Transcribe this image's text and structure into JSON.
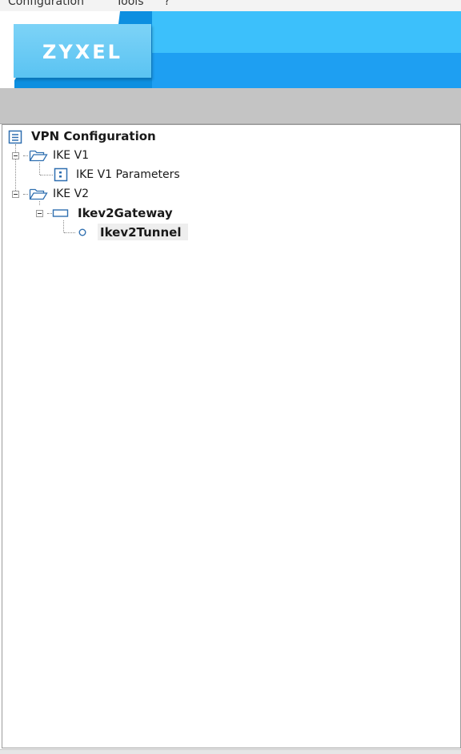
{
  "menubar": {
    "items": [
      {
        "label": "Configuration"
      },
      {
        "label": "Tools"
      },
      {
        "label": "?"
      }
    ]
  },
  "banner": {
    "logo_text": "ZYXEL",
    "colors": {
      "accent": "#29b6f6",
      "light": "#7dd3f7",
      "dark": "#0d8fe0"
    }
  },
  "tree": {
    "root": {
      "label": "VPN Configuration",
      "icon": "list-icon"
    },
    "ike_v1": {
      "label": "IKE V1",
      "icon": "folder-open-icon"
    },
    "ike_v1_params": {
      "label": "IKE V1 Parameters",
      "icon": "parameters-icon"
    },
    "ike_v2": {
      "label": "IKE V2",
      "icon": "folder-open-icon"
    },
    "gateway": {
      "label": "Ikev2Gateway",
      "icon": "gateway-icon"
    },
    "tunnel": {
      "label": "Ikev2Tunnel",
      "icon": "tunnel-icon",
      "selected": true
    }
  }
}
